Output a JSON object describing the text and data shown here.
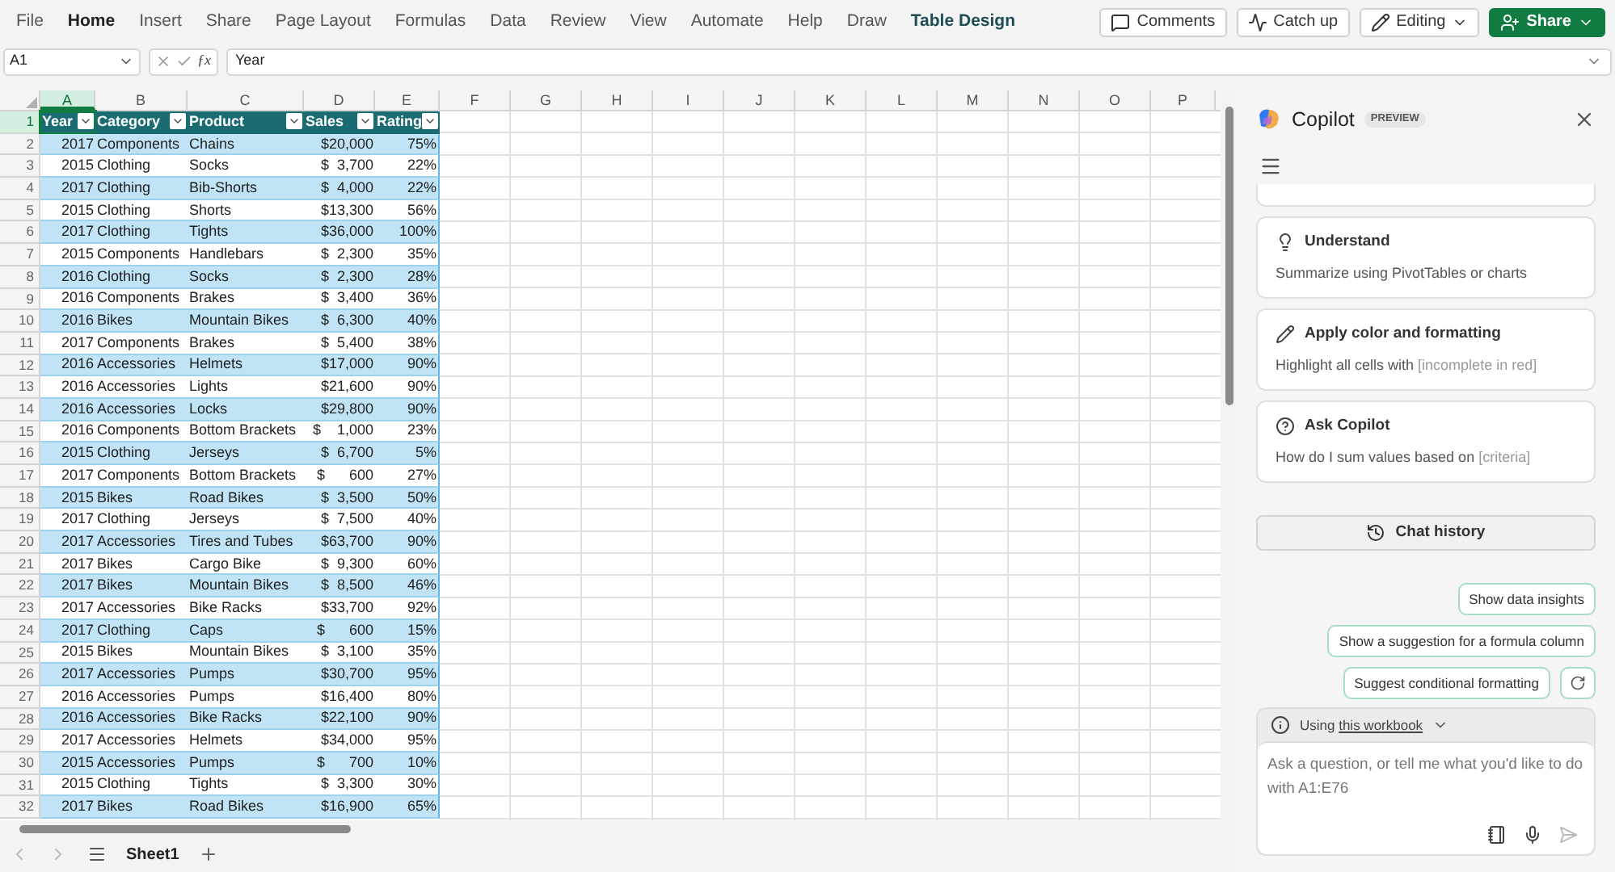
{
  "ribbon": {
    "tabs": [
      {
        "label": "File",
        "selected": false
      },
      {
        "label": "Home",
        "selected": true
      },
      {
        "label": "Insert",
        "selected": false
      },
      {
        "label": "Share",
        "selected": false
      },
      {
        "label": "Page Layout",
        "selected": false
      },
      {
        "label": "Formulas",
        "selected": false
      },
      {
        "label": "Data",
        "selected": false
      },
      {
        "label": "Review",
        "selected": false
      },
      {
        "label": "View",
        "selected": false
      },
      {
        "label": "Automate",
        "selected": false
      },
      {
        "label": "Help",
        "selected": false
      },
      {
        "label": "Draw",
        "selected": false
      },
      {
        "label": "Table Design",
        "selected": false,
        "contextual": true
      }
    ],
    "actions": [
      {
        "kind": "comments",
        "label": "Comments"
      },
      {
        "kind": "catchup",
        "label": "Catch up"
      },
      {
        "kind": "editing",
        "label": "Editing"
      },
      {
        "kind": "share",
        "label": "Share"
      }
    ]
  },
  "formula_bar": {
    "name_box": "A1",
    "function_label": "ƒx",
    "value": "Year"
  },
  "sheet": {
    "columns": [
      {
        "label": "A",
        "selected": true
      },
      {
        "label": "B",
        "selected": false
      },
      {
        "label": "C",
        "selected": false
      },
      {
        "label": "D",
        "selected": false
      },
      {
        "label": "E",
        "selected": false
      },
      {
        "label": "F",
        "selected": false
      },
      {
        "label": "G",
        "selected": false
      },
      {
        "label": "H",
        "selected": false
      },
      {
        "label": "I",
        "selected": false
      },
      {
        "label": "J",
        "selected": false
      },
      {
        "label": "K",
        "selected": false
      },
      {
        "label": "L",
        "selected": false
      },
      {
        "label": "M",
        "selected": false
      },
      {
        "label": "N",
        "selected": false
      },
      {
        "label": "O",
        "selected": false
      },
      {
        "label": "P",
        "selected": false
      }
    ],
    "row_numbers": [
      "1",
      "2",
      "3",
      "4",
      "5",
      "6",
      "7",
      "8",
      "9",
      "10",
      "11",
      "12",
      "13",
      "14",
      "15",
      "16",
      "17",
      "18",
      "19",
      "20",
      "21",
      "22",
      "23",
      "24",
      "25",
      "26",
      "27",
      "28",
      "29",
      "30",
      "31",
      "32"
    ],
    "table_header": [
      "Year",
      "Category",
      "Product",
      "Sales",
      "Rating"
    ],
    "rows": [
      [
        "2017",
        "Components",
        "Chains",
        "$20,000",
        "75%"
      ],
      [
        "2015",
        "Clothing",
        "Socks",
        "$  3,700",
        "22%"
      ],
      [
        "2017",
        "Clothing",
        "Bib-Shorts",
        "$  4,000",
        "22%"
      ],
      [
        "2015",
        "Clothing",
        "Shorts",
        "$13,300",
        "56%"
      ],
      [
        "2017",
        "Clothing",
        "Tights",
        "$36,000",
        "100%"
      ],
      [
        "2015",
        "Components",
        "Handlebars",
        "$  2,300",
        "35%"
      ],
      [
        "2016",
        "Clothing",
        "Socks",
        "$  2,300",
        "28%"
      ],
      [
        "2016",
        "Components",
        "Brakes",
        "$  3,400",
        "36%"
      ],
      [
        "2016",
        "Bikes",
        "Mountain Bikes",
        "$  6,300",
        "40%"
      ],
      [
        "2017",
        "Components",
        "Brakes",
        "$  5,400",
        "38%"
      ],
      [
        "2016",
        "Accessories",
        "Helmets",
        "$17,000",
        "90%"
      ],
      [
        "2016",
        "Accessories",
        "Lights",
        "$21,600",
        "90%"
      ],
      [
        "2016",
        "Accessories",
        "Locks",
        "$29,800",
        "90%"
      ],
      [
        "2016",
        "Components",
        "Bottom Brackets",
        "$    1,000",
        "23%"
      ],
      [
        "2015",
        "Clothing",
        "Jerseys",
        "$  6,700",
        "5%"
      ],
      [
        "2017",
        "Components",
        "Bottom Brackets",
        "$      600",
        "27%"
      ],
      [
        "2015",
        "Bikes",
        "Road Bikes",
        "$  3,500",
        "50%"
      ],
      [
        "2017",
        "Clothing",
        "Jerseys",
        "$  7,500",
        "40%"
      ],
      [
        "2017",
        "Accessories",
        "Tires and Tubes",
        "$63,700",
        "90%"
      ],
      [
        "2017",
        "Bikes",
        "Cargo Bike",
        "$  9,300",
        "60%"
      ],
      [
        "2017",
        "Bikes",
        "Mountain Bikes",
        "$  8,500",
        "46%"
      ],
      [
        "2017",
        "Accessories",
        "Bike Racks",
        "$33,700",
        "92%"
      ],
      [
        "2017",
        "Clothing",
        "Caps",
        "$      600",
        "15%"
      ],
      [
        "2015",
        "Bikes",
        "Mountain Bikes",
        "$  3,100",
        "35%"
      ],
      [
        "2017",
        "Accessories",
        "Pumps",
        "$30,700",
        "95%"
      ],
      [
        "2016",
        "Accessories",
        "Pumps",
        "$16,400",
        "80%"
      ],
      [
        "2016",
        "Accessories",
        "Bike Racks",
        "$22,100",
        "90%"
      ],
      [
        "2017",
        "Accessories",
        "Helmets",
        "$34,000",
        "95%"
      ],
      [
        "2015",
        "Accessories",
        "Pumps",
        "$      700",
        "10%"
      ],
      [
        "2015",
        "Clothing",
        "Tights",
        "$  3,300",
        "30%"
      ],
      [
        "2017",
        "Bikes",
        "Road Bikes",
        "$16,900",
        "65%"
      ]
    ],
    "sheet_tabs": [
      {
        "label": "Sheet1",
        "selected": true
      }
    ]
  },
  "copilot": {
    "title": "Copilot",
    "badge": "PREVIEW",
    "cards": [
      {
        "kind": "understand",
        "title": "Understand",
        "text": "Summarize using PivotTables or charts"
      },
      {
        "kind": "format",
        "title": "Apply color and formatting",
        "text": "Highlight all cells with ",
        "hint": "[incomplete in red]"
      },
      {
        "kind": "ask",
        "title": "Ask Copilot",
        "text": "How do I sum values based on ",
        "hint": "[criteria]"
      }
    ],
    "chat_history": "Chat history",
    "suggestions": [
      "Show data insights",
      "Show a suggestion for a formula column",
      "Suggest conditional formatting"
    ],
    "context": {
      "prefix": "Using ",
      "link": "this workbook"
    },
    "input": {
      "placeholder": "Ask a question, or tell me what you'd like to do with A1:E76"
    }
  }
}
